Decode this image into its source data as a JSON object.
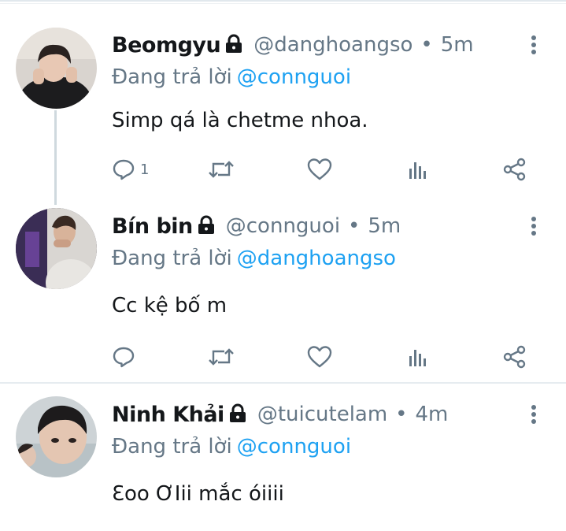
{
  "tweets": [
    {
      "name": "Beomgyu",
      "handle": "@danghoangso",
      "dot": "•",
      "time": "5m",
      "reply_prefix": "Đang trả lời",
      "reply_to": "@connguoi",
      "text": "Simp qá là chetme nhoa.",
      "reply_count": "1"
    },
    {
      "name": "Bín bin",
      "handle": "@connguoi",
      "dot": "•",
      "time": "5m",
      "reply_prefix": "Đang trả lời",
      "reply_to": "@danghoangso",
      "text": "Cc kệ bố m",
      "reply_count": ""
    },
    {
      "name": "Ninh Khải",
      "handle": "@tuicutelam",
      "dot": "•",
      "time": "4m",
      "reply_prefix": "Đang trả lời",
      "reply_to": "@connguoi",
      "text": "Ɛoo ƠIii mắc óiiii",
      "reply_count": ""
    }
  ],
  "icons": {
    "reply": "reply-icon",
    "retweet": "retweet-icon",
    "like": "heart-icon",
    "analytics": "analytics-icon",
    "share": "share-icon",
    "lock": "lock-icon",
    "more": "more-vertical-icon"
  },
  "colors": {
    "link": "#1da1f2",
    "secondary": "#657786",
    "text": "#14171a"
  }
}
